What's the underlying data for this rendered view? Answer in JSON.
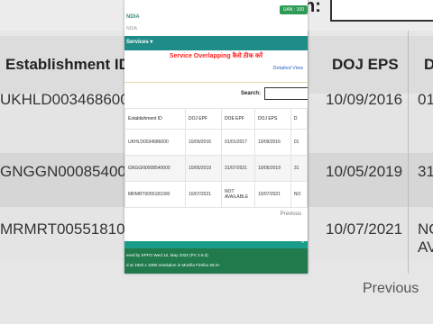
{
  "page_heading": "Service Overlapping कैसे ठीक करें",
  "header": {
    "org_text": "NDIA",
    "org_subtext": "NDIA",
    "uan_badge": "UAN : 100",
    "nav_services": "Services ▾"
  },
  "detailed_view_link": "Detailed View",
  "search": {
    "label": "Search:",
    "bg_label": "h:"
  },
  "table": {
    "columns": [
      "Establishment ID",
      "DOJ EPF",
      "DOE EPF",
      "DOJ EPS",
      "D"
    ],
    "rows": [
      [
        "UKHLD0034686000",
        "10/09/2016",
        "01/01/2017",
        "10/09/2016",
        "01"
      ],
      [
        "GNGGN0008540000",
        "10/05/2019",
        "31/07/2021",
        "10/05/2019",
        "31"
      ],
      [
        "MRMRT0055181000",
        "10/07/2021",
        "NOT AVAILABLE",
        "10/07/2021",
        "NO"
      ]
    ]
  },
  "pagination": {
    "previous": "Previous"
  },
  "footer": {
    "caret": "^",
    "line1": "ered by EPFO Wed 10, May 2023 (PV 2.9.0)",
    "line2": "d at 1920 x 1080 resolution in Mozilla Firefox 58.0+"
  },
  "background": {
    "columns": [
      "Establishment ID",
      "DOJ EPS",
      "D"
    ],
    "rows": [
      [
        "UKHLD0034686000",
        "10/09/2016",
        "01"
      ],
      [
        "GNGGN0008540000",
        "10/05/2019",
        "31"
      ],
      [
        "MRMRT0055181000",
        "10/07/2021",
        "NO"
      ]
    ],
    "row3_extra": "AV",
    "previous": "Previous"
  }
}
